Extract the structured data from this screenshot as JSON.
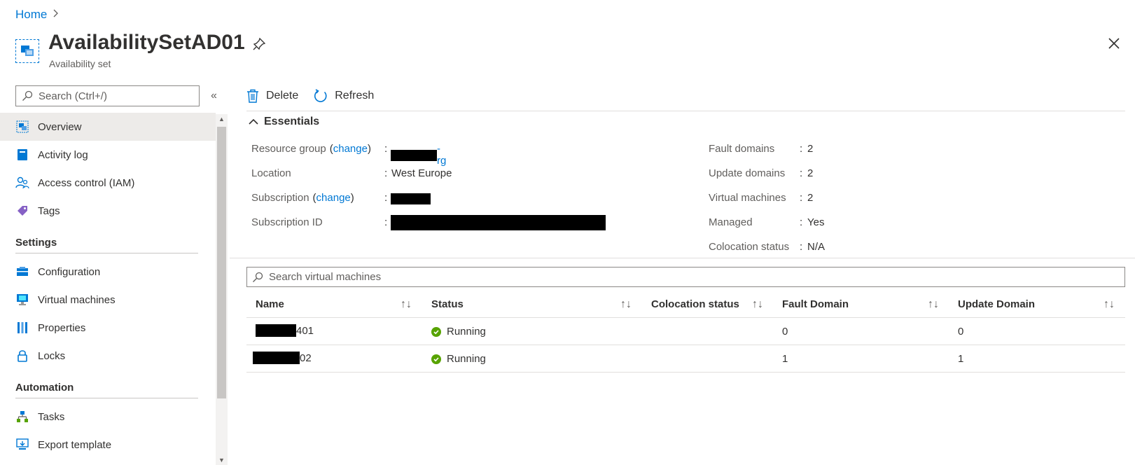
{
  "breadcrumb": {
    "home": "Home",
    "separator": ">"
  },
  "header": {
    "title": "AvailabilitySetAD01",
    "subtitle": "Availability set",
    "icons": [
      "availability-set-icon",
      "pin-icon",
      "close-icon"
    ]
  },
  "sidebar": {
    "search_placeholder": "Search (Ctrl+/)",
    "collapse_label": "«",
    "items": [
      {
        "label": "Overview",
        "icon": "overview-icon",
        "active": true
      },
      {
        "label": "Activity log",
        "icon": "activity-log-icon"
      },
      {
        "label": "Access control (IAM)",
        "icon": "iam-icon"
      },
      {
        "label": "Tags",
        "icon": "tag-icon"
      }
    ],
    "sections": [
      {
        "title": "Settings",
        "items": [
          {
            "label": "Configuration",
            "icon": "configuration-icon"
          },
          {
            "label": "Virtual machines",
            "icon": "virtual-machine-icon"
          },
          {
            "label": "Properties",
            "icon": "properties-icon"
          },
          {
            "label": "Locks",
            "icon": "lock-icon"
          }
        ]
      },
      {
        "title": "Automation",
        "items": [
          {
            "label": "Tasks",
            "icon": "tasks-icon"
          },
          {
            "label": "Export template",
            "icon": "export-template-icon"
          }
        ]
      }
    ]
  },
  "toolbar": {
    "delete_label": "Delete",
    "refresh_label": "Refresh"
  },
  "essentials": {
    "title": "Essentials",
    "left": [
      {
        "label": "Resource group",
        "change": "change",
        "value_suffix": "-rg",
        "redacted": true
      },
      {
        "label": "Location",
        "value": "West Europe"
      },
      {
        "label": "Subscription",
        "change": "change",
        "redacted": true
      },
      {
        "label": "Subscription ID",
        "redacted": true
      }
    ],
    "right": [
      {
        "label": "Fault domains",
        "value": "2"
      },
      {
        "label": "Update domains",
        "value": "2"
      },
      {
        "label": "Virtual machines",
        "value": "2"
      },
      {
        "label": "Managed",
        "value": "Yes"
      },
      {
        "label": "Colocation status",
        "value": "N/A"
      }
    ]
  },
  "vm_table": {
    "search_placeholder": "Search virtual machines",
    "columns": [
      "Name",
      "Status",
      "Colocation status",
      "Fault Domain",
      "Update Domain"
    ],
    "rows": [
      {
        "name_suffix": "401",
        "status": "Running",
        "colocation": "",
        "fault_domain": "0",
        "update_domain": "0"
      },
      {
        "name_suffix": "02",
        "status": "Running",
        "colocation": "",
        "fault_domain": "1",
        "update_domain": "1"
      }
    ]
  },
  "colors": {
    "accent": "#0078d4",
    "success": "#57a300",
    "text": "#323130",
    "muted": "#605e5c"
  }
}
